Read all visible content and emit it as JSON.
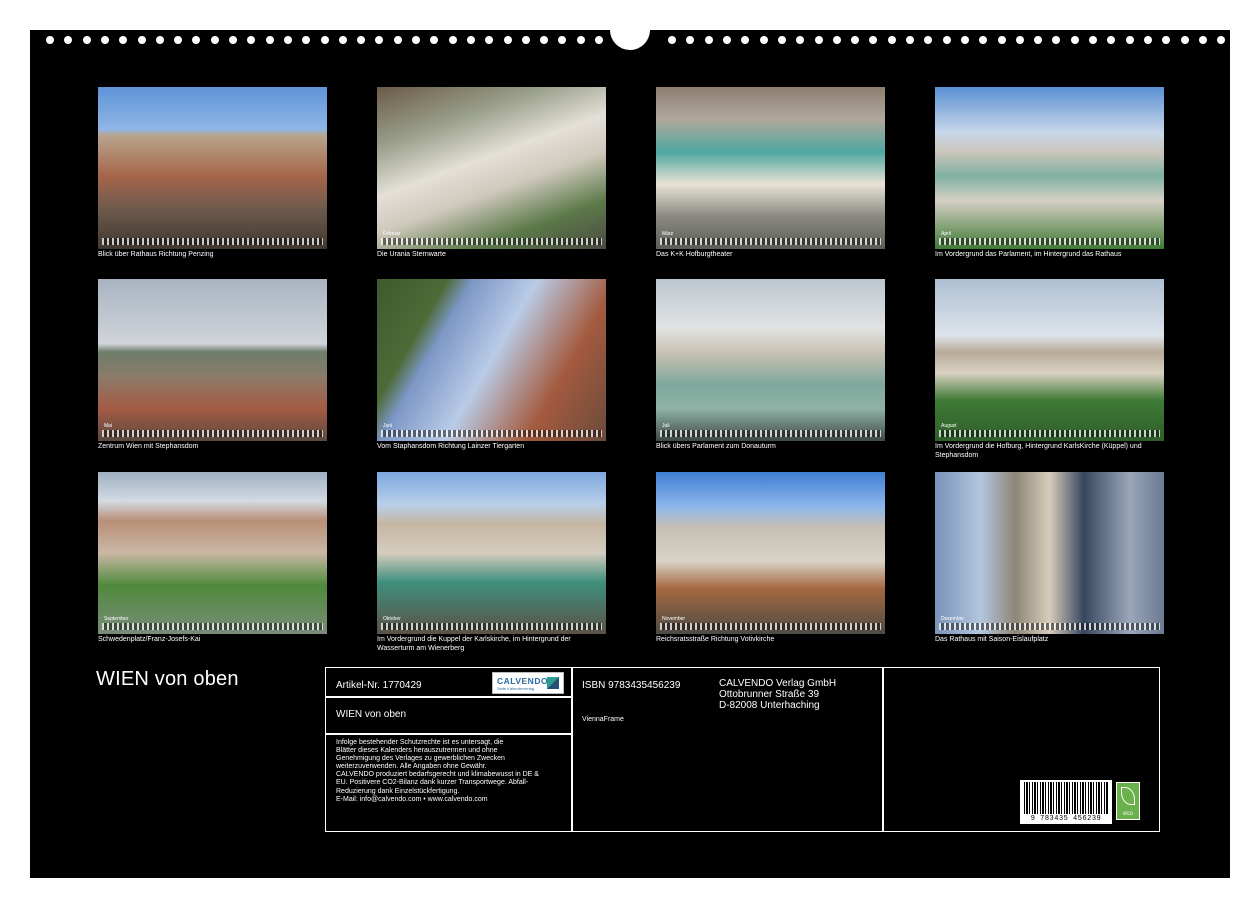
{
  "calendar": {
    "title": "WIEN von oben",
    "photos": [
      {
        "caption": "Blick über Rathaus Richtung Penzing",
        "month": ""
      },
      {
        "caption": "Die Urania Sternwarte",
        "month": "Februar"
      },
      {
        "caption": "Das K+K Hofburgtheater",
        "month": "März"
      },
      {
        "caption": "Im Vordergrund das Parlament, im Hintergrund das Rathaus",
        "month": "April"
      },
      {
        "caption": "Zentrum Wien mit Stephansdom",
        "month": "Mai"
      },
      {
        "caption": "Vom Staphansdom Richtung Lainzer Tiergarten",
        "month": "Juni"
      },
      {
        "caption": "Blick übers Parlament zum Donauturm",
        "month": "Juli"
      },
      {
        "caption": "Im Vordergrund die Hofburg, Hintergrund KarlsKirche (Küppel) und Stephansdom",
        "month": "August"
      },
      {
        "caption": "Schwedenplatz/Franz-Josefs-Kai",
        "month": "September"
      },
      {
        "caption": "Im Vordergrund die Kuppel der Karlskirche, im Hintergrund der Wasserturm am Wienerberg",
        "month": "Oktober"
      },
      {
        "caption": "Reichsratsstraße Richtung Votivkirche",
        "month": "November"
      },
      {
        "caption": "Das Rathaus mit Saison-Eislaufplatz",
        "month": "Dezember"
      }
    ]
  },
  "info": {
    "article": "Artikel-Nr. 1770429",
    "title_repeat": "WIEN von oben",
    "legal": [
      "Infolge bestehender Schutzrechte ist es untersagt, die",
      "Blätter dieses Kalenders herauszutrennen und ohne",
      "Genehmigung des Verlages zu gewerblichen Zwecken",
      "weiterzuverwenden. Alle Angaben ohne Gewähr.",
      "CALVENDO produziert bedarfsgerecht und klimabewusst in DE &",
      "EU. Positivere CO2-Bilanz dank kurzer Transportwege. Abfall-",
      "Reduzierung dank Einzelstückfertigung.",
      "E-Mail: info@calvendo.com • www.calvendo.com"
    ],
    "isbn": "ISBN 9783435456239",
    "author": "ViennaFrame",
    "publisher": [
      "CALVENDO Verlag GmbH",
      "Ottobrunner Straße 39",
      "D-82008 Unterhaching"
    ],
    "logo_text": "CALVENDO",
    "logo_sub": "Seite Kalenderverlag",
    "barcode_number": "9 783435 456239",
    "eco_label": "eco"
  },
  "colors": {
    "sheet": "#000000",
    "text": "#ffffff",
    "eco": "#6ab04c"
  }
}
